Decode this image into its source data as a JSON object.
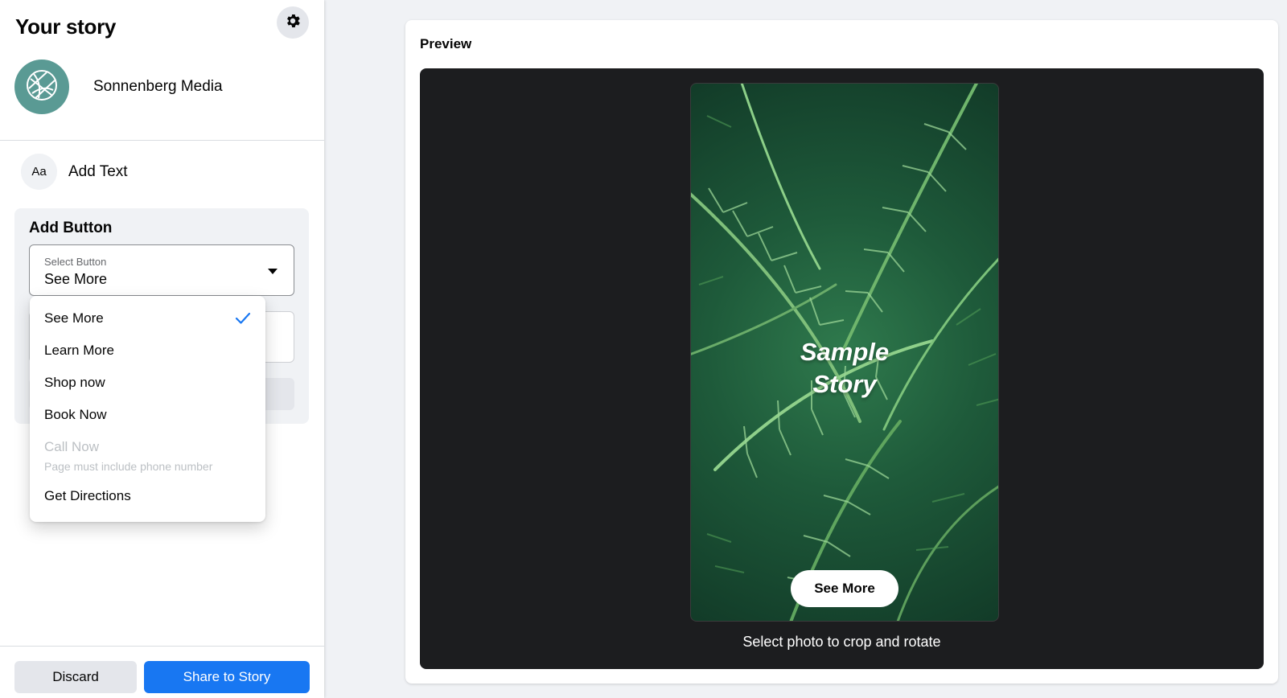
{
  "sidebar": {
    "title": "Your story",
    "profile_name": "Sonnenberg Media",
    "add_text_icon": "Aa",
    "add_text_label": "Add Text",
    "add_button": {
      "title": "Add Button",
      "select_label": "Select Button",
      "select_value": "See More",
      "options": [
        {
          "label": "See More",
          "selected": true
        },
        {
          "label": "Learn More"
        },
        {
          "label": "Shop now"
        },
        {
          "label": "Book Now"
        },
        {
          "label": "Call Now",
          "disabled": true,
          "note": "Page must include phone number"
        },
        {
          "label": "Get Directions"
        }
      ]
    },
    "footer": {
      "discard_label": "Discard",
      "share_label": "Share to Story"
    }
  },
  "preview": {
    "title": "Preview",
    "story_text_line1": "Sample",
    "story_text_line2": "Story",
    "cta_label": "See More",
    "caption": "Select photo to crop and rotate"
  },
  "icons": {
    "settings": "gear-icon",
    "avatar": "globe-logo-icon",
    "check": "check-icon",
    "caret": "chevron-down-icon"
  },
  "colors": {
    "accent": "#1877f2",
    "avatar_bg": "#5a9a94",
    "preview_bg": "#1c1d1f"
  }
}
